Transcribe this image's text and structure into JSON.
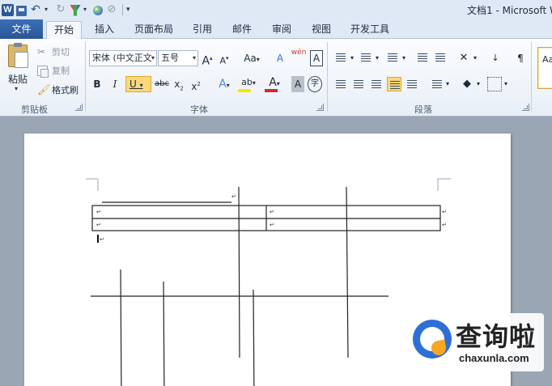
{
  "app": {
    "title": "文档1 - Microsoft W"
  },
  "quick_access": {
    "logo": "W",
    "items": [
      "word-logo-icon",
      "save-icon",
      "undo-icon",
      "redo-icon",
      "brush-icon",
      "color-ball-icon",
      "no-edit-icon",
      "customize-icon"
    ]
  },
  "tabs": {
    "file": "文件",
    "items": [
      {
        "label": "开始",
        "active": true
      },
      {
        "label": "插入"
      },
      {
        "label": "页面布局"
      },
      {
        "label": "引用"
      },
      {
        "label": "邮件"
      },
      {
        "label": "审阅"
      },
      {
        "label": "视图"
      },
      {
        "label": "开发工具"
      }
    ]
  },
  "ribbon": {
    "clipboard": {
      "label": "剪贴板",
      "paste": "粘贴",
      "cut": "剪切",
      "copy": "复制",
      "format_painter": "格式刷"
    },
    "font": {
      "label": "字体",
      "font_name": "宋体 (中文正文",
      "font_size": "五号",
      "grow": "A",
      "shrink": "A",
      "change_case": "Aa",
      "clear": "A",
      "phonetic": "wén",
      "char_border": "A",
      "bold": "B",
      "italic": "I",
      "underline": "U",
      "strike": "abc",
      "subscript": "x",
      "superscript": "x",
      "text_effects": "A",
      "highlight": "ab",
      "font_color": "A",
      "char_shading": "A",
      "enclose": "字",
      "colors": {
        "highlight": "#f5e600",
        "font_color": "#d42a2a",
        "accent": "#fbd87a"
      }
    },
    "paragraph": {
      "label": "段落"
    },
    "styles": {
      "preview": "Aa"
    }
  },
  "document": {
    "paragraph_mark": "↵"
  },
  "watermark": {
    "text": "查询啦",
    "url": "chaxunla.com"
  }
}
